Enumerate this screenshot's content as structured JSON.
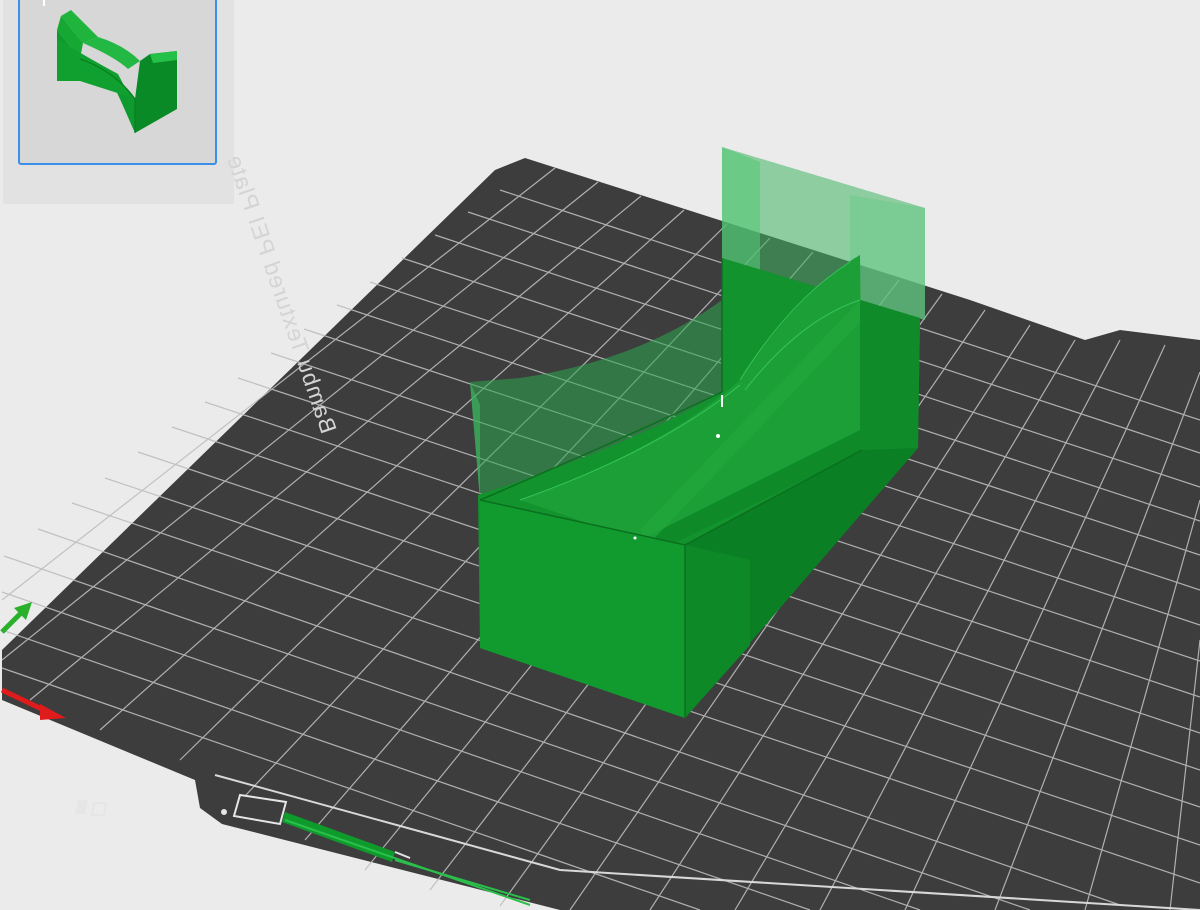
{
  "plate": {
    "label": "Bambu Textured PEI Plate",
    "surface_color": "#3d3d3d",
    "grid_color": "#bdbdbd",
    "background_color": "#ebebeb"
  },
  "plate_thumbnail": {
    "selected": true,
    "border_color": "#3b8fe6"
  },
  "model": {
    "color": "#109a2c",
    "transparent_color": "#2ea84f"
  },
  "axes": {
    "x_color": "#e01b1b",
    "y_color": "#2ab02a"
  },
  "icons": {
    "axis_gizmo": "xyz-axis-gizmo-icon",
    "plate_badge": "bambu-plate-badge-icon"
  }
}
